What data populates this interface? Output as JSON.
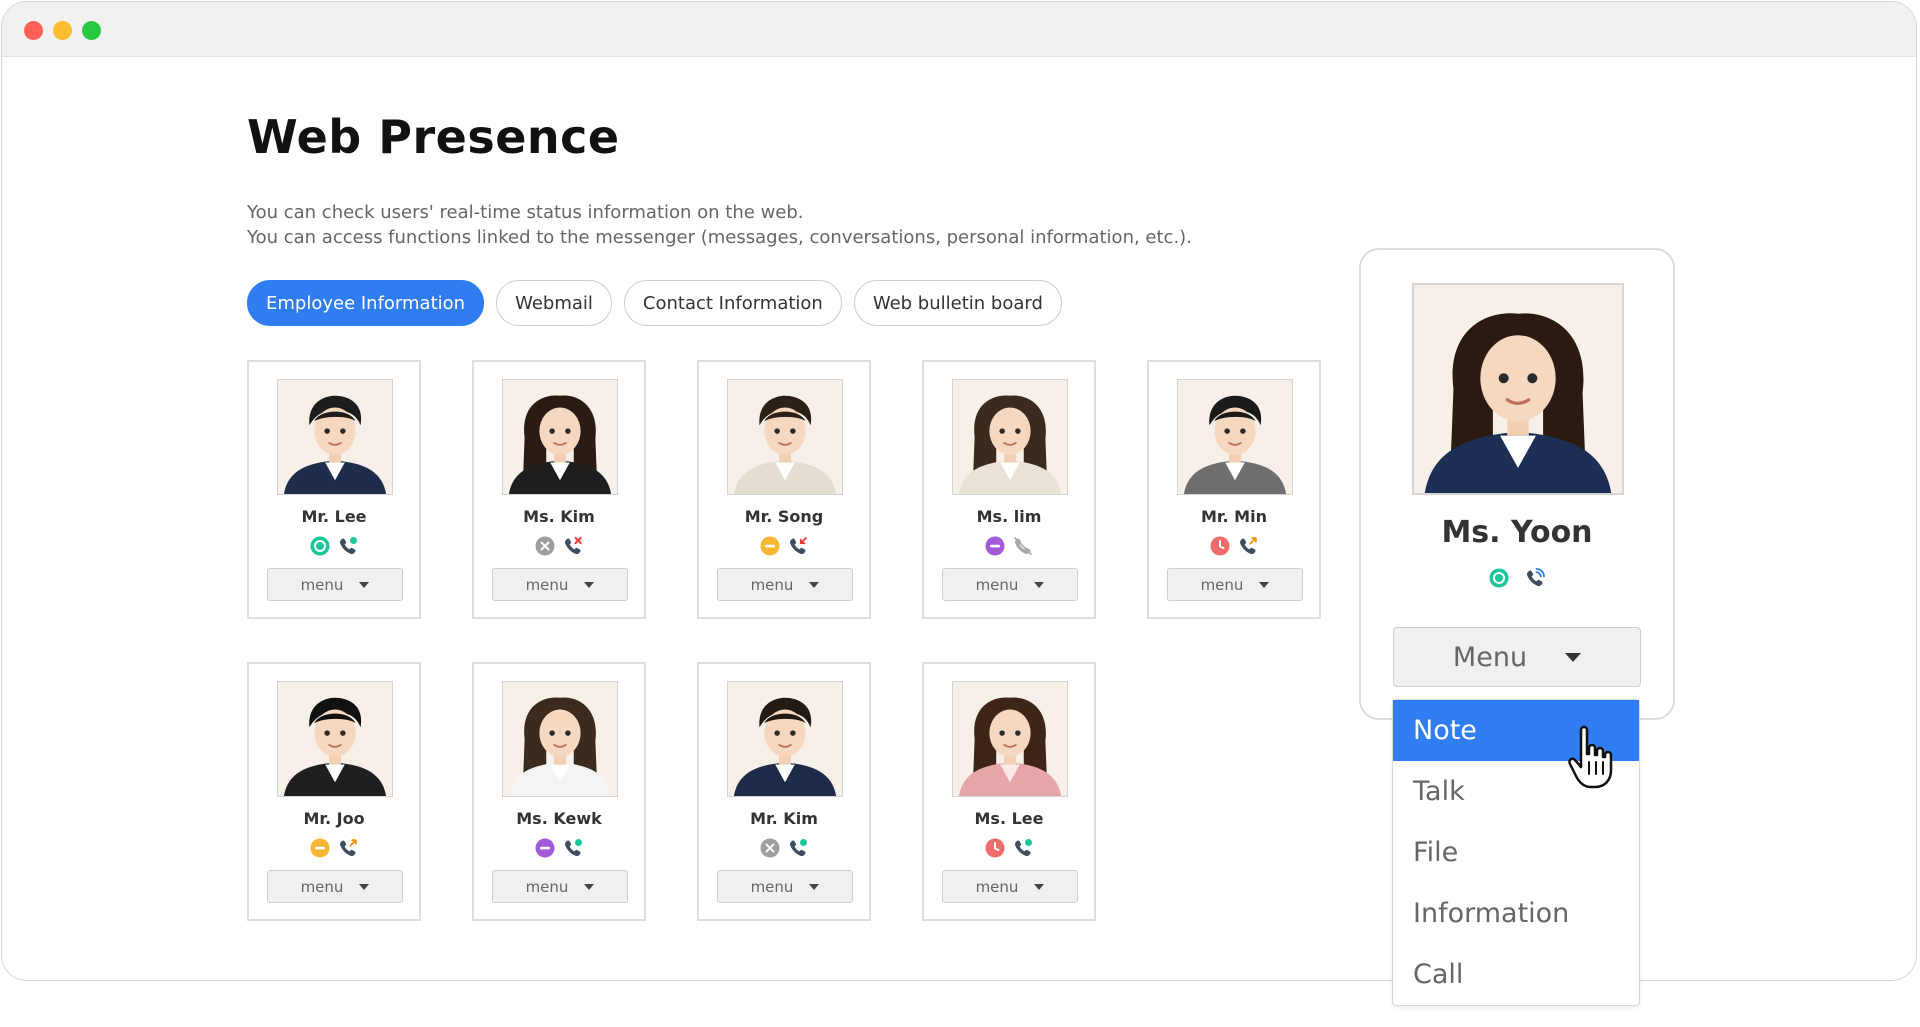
{
  "page": {
    "title": "Web Presence",
    "description": [
      "You can check users' real-time status information on the web.",
      "You can access functions linked to the messenger (messages, conversations, personal information, etc.)."
    ]
  },
  "tabs": [
    {
      "label": "Employee Information",
      "active": true
    },
    {
      "label": "Webmail",
      "active": false
    },
    {
      "label": "Contact Information",
      "active": false
    },
    {
      "label": "Web bulletin board",
      "active": false
    }
  ],
  "employees": [
    {
      "name": "Mr. Lee",
      "status": "online",
      "phone": "on-call",
      "menu": "menu"
    },
    {
      "name": "Ms. Kim",
      "status": "offline",
      "phone": "unavailable",
      "menu": "menu"
    },
    {
      "name": "Mr. Song",
      "status": "busy",
      "phone": "incoming",
      "menu": "menu"
    },
    {
      "name": "Ms. lim",
      "status": "do-not-disturb",
      "phone": "disabled",
      "menu": "menu"
    },
    {
      "name": "Mr. Min",
      "status": "away",
      "phone": "outgoing",
      "menu": "menu"
    },
    {
      "name": "Mr. Joo",
      "status": "busy",
      "phone": "outgoing",
      "menu": "menu"
    },
    {
      "name": "Ms. Kewk",
      "status": "do-not-disturb",
      "phone": "on-call",
      "menu": "menu"
    },
    {
      "name": "Mr. Kim",
      "status": "offline",
      "phone": "on-call",
      "menu": "menu"
    },
    {
      "name": "Ms. Lee",
      "status": "away",
      "phone": "on-call",
      "menu": "menu"
    }
  ],
  "selected_profile": {
    "name": "Ms. Yoon",
    "status": "online",
    "phone": "ringing",
    "menu_label": "Menu",
    "menu_options": [
      "Note",
      "Talk",
      "File",
      "Information",
      "Call"
    ],
    "highlighted_option": "Note"
  },
  "icons": {
    "status_online": "online-ring-icon",
    "status_offline": "offline-x-icon",
    "status_busy": "busy-minus-icon",
    "status_dnd": "dnd-minus-icon",
    "status_away": "away-clock-icon",
    "phone": "phone-icon",
    "dropdown": "caret-down-icon",
    "cursor": "hand-pointer-icon"
  },
  "colors": {
    "accent": "#2f7df0",
    "online": "#1bc59a",
    "offline": "#9e9e9e",
    "busy": "#f7b733",
    "dnd": "#a35ad8",
    "away": "#f06b6b",
    "phone_badge_red": "#e53935",
    "phone_badge_orange": "#f39200",
    "phone_badge_green": "#1bc59a",
    "phone_badge_blue": "#2f7df0"
  }
}
